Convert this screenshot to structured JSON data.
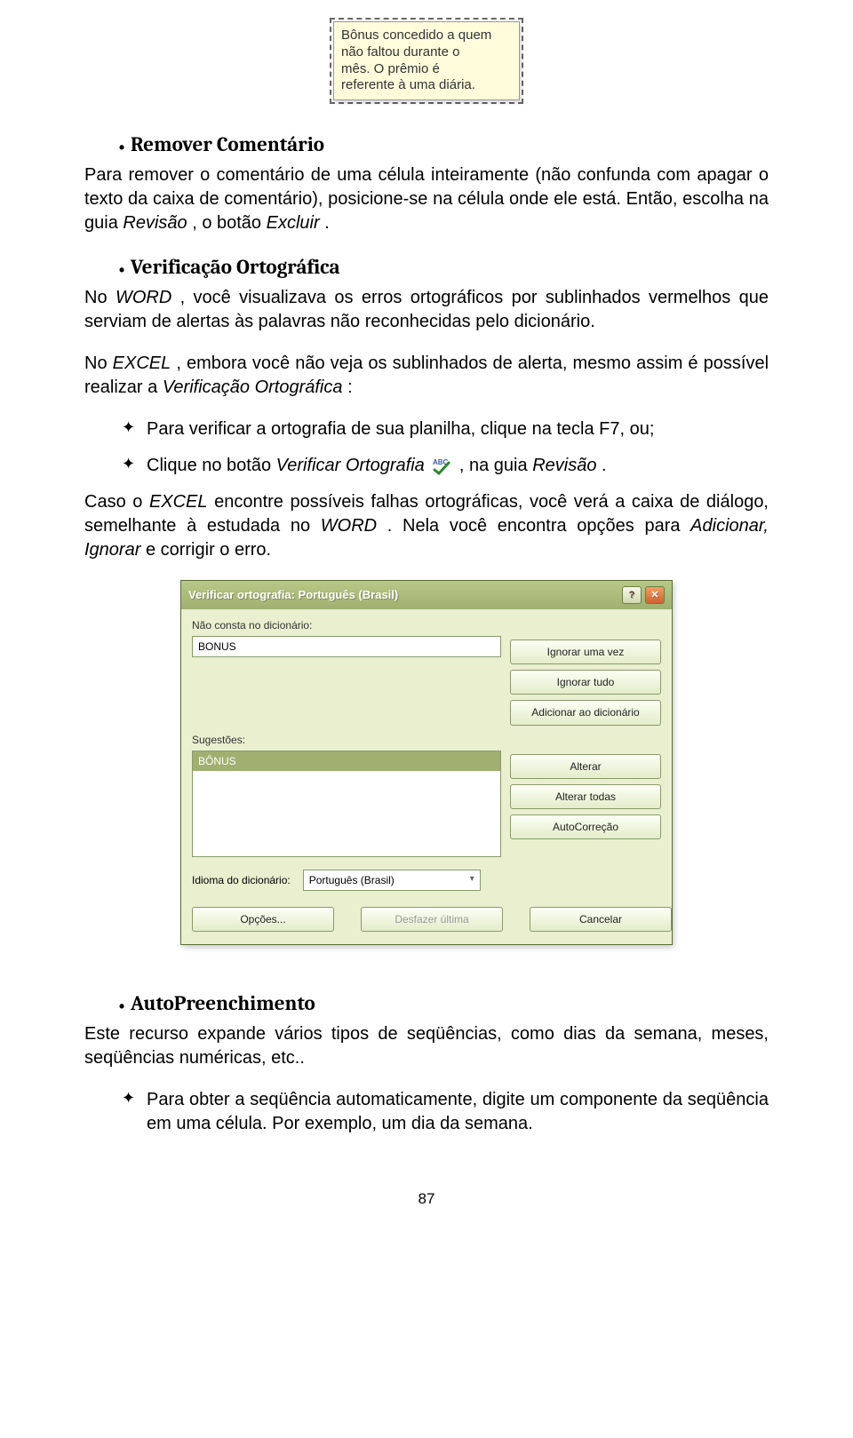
{
  "comment_note": {
    "line1": "Bônus concedido a quem",
    "line2": "não faltou durante o",
    "line3": "mês. O prêmio é",
    "line4": "referente à uma diária."
  },
  "section_remover": {
    "title": "Remover Comentário",
    "p1a": "Para remover o comentário de uma célula inteiramente (não confunda com apagar o texto da caixa de comentário), posicione-se na célula onde ele está. Então, escolha na guia ",
    "p1b": "Revisão",
    "p1c": ", o botão ",
    "p1d": "Excluir",
    "p1e": "."
  },
  "section_verif": {
    "title": "Verificação Ortográfica",
    "p1a": "No ",
    "p1b": "WORD",
    "p1c": ", você visualizava os erros ortográficos por sublinhados vermelhos que serviam de alertas às palavras não reconhecidas pelo dicionário.",
    "p2a": "No ",
    "p2b": "EXCEL",
    "p2c": ", embora você não veja os sublinhados de alerta, mesmo assim é possível realizar a ",
    "p2d": "Verificação Ortográfica",
    "p2e": ":",
    "s1": "Para verificar a ortografia de sua planilha, clique na tecla F7, ou;",
    "s2a": "Clique no botão ",
    "s2b": "Verificar Ortografia",
    "s2c": " , na guia ",
    "s2d": "Revisão",
    "s2e": ".",
    "p3a": "Caso o ",
    "p3b": "EXCEL",
    "p3c": " encontre possíveis falhas ortográficas, você verá a caixa de diálogo, semelhante à estudada no ",
    "p3d": "WORD",
    "p3e": ". Nela você encontra opções para ",
    "p3f": "Adicionar, Ignorar",
    "p3g": " e corrigir o erro."
  },
  "dialog": {
    "title": "Verificar ortografia: Português (Brasil)",
    "label_nao_consta": "Não consta no dicionário:",
    "input_value": "BONUS",
    "btn_ignorar_uma": "Ignorar uma vez",
    "btn_ignorar_tudo": "Ignorar tudo",
    "btn_adicionar": "Adicionar ao dicionário",
    "label_sugestoes": "Sugestões:",
    "suggestion1": "BÔNUS",
    "btn_alterar": "Alterar",
    "btn_alterar_todas": "Alterar todas",
    "btn_autocorrecao": "AutoCorreção",
    "label_idioma": "Idioma do dicionário:",
    "idioma_value": "Português (Brasil)",
    "btn_opcoes": "Opções...",
    "btn_desfazer": "Desfazer última",
    "btn_cancelar": "Cancelar"
  },
  "section_auto": {
    "title": "AutoPreenchimento",
    "p1": "Este recurso expande vários tipos de seqüências, como dias da semana, meses, seqüências numéricas, etc..",
    "s1": "Para obter a seqüência automaticamente, digite um componente da seqüência em uma célula. Por exemplo, um dia da semana."
  },
  "page_number": "87"
}
